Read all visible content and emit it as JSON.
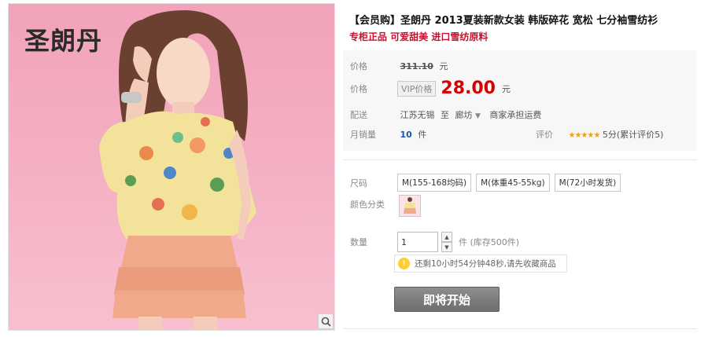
{
  "product": {
    "title": "【会员购】圣朗丹 2013夏装新款女装 韩版碎花 宽松 七分袖雪纺衫",
    "subtitle": "专柜正品 可爱甜美 进口雪纺原料"
  },
  "photo": {
    "brand_logo": "圣朗丹",
    "zoom_icon": "magnifier-icon"
  },
  "price": {
    "label": "价格",
    "original": "311.10",
    "unit": "元"
  },
  "sale": {
    "label": "价格",
    "vip_tag": "VIP价格",
    "value": "28.00",
    "unit": "元"
  },
  "shipping": {
    "label": "配送",
    "from": "江苏无锡",
    "to_word": "至",
    "destination": "廊坊",
    "info": "商家承担运费"
  },
  "sales": {
    "label": "月销量",
    "count": "10",
    "unit": "件"
  },
  "review": {
    "label": "评价",
    "stars": "★★★★★",
    "text": "5分(累计评价5)",
    "color": "#f5a000"
  },
  "size": {
    "label": "尺码",
    "options": [
      "M(155-168均码)",
      "M(体重45-55kg)",
      "M(72小时发货)"
    ]
  },
  "color_category": {
    "label": "颜色分类"
  },
  "quantity": {
    "label": "数量",
    "value": "1",
    "unit_text": "件 (库存500件)"
  },
  "notice": {
    "text": "还剩10小时54分钟48秒,请先收藏商品"
  },
  "buy_button": {
    "label": "即将开始"
  },
  "colors": {
    "accent_red": "#d50000",
    "subtitle_red": "#c8102e",
    "button_gray": "#7e7e7e",
    "photo_background": "#f2a3b9"
  }
}
